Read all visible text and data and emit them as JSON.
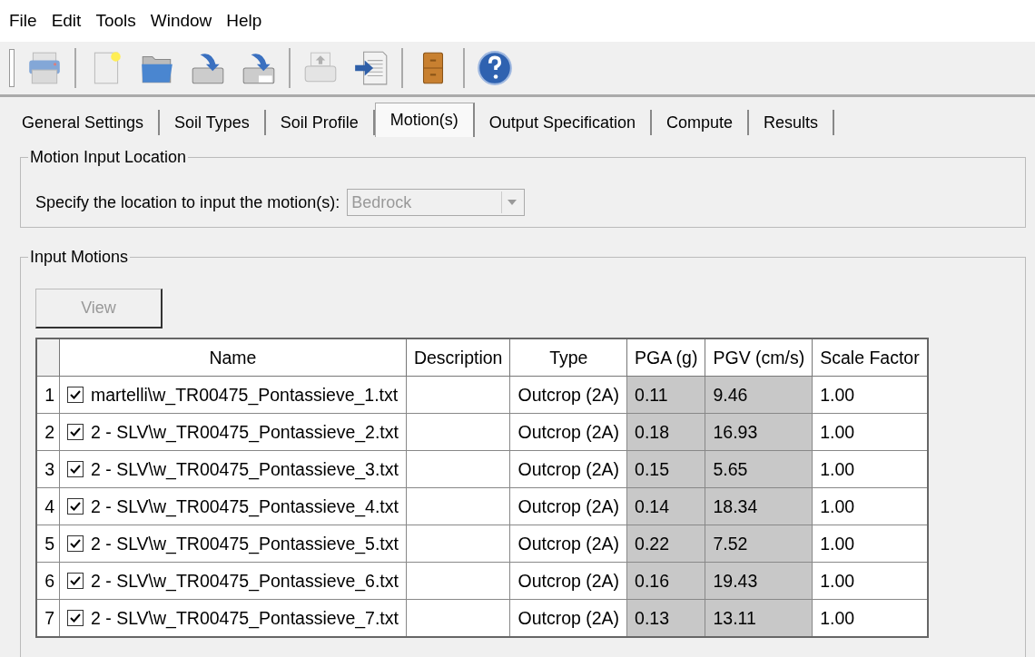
{
  "menu": [
    "File",
    "Edit",
    "Tools",
    "Window",
    "Help"
  ],
  "toolbar": [
    {
      "kind": "printer",
      "disabled": true
    },
    {
      "kind": "sep"
    },
    {
      "kind": "new",
      "disabled": false
    },
    {
      "kind": "open",
      "disabled": false
    },
    {
      "kind": "save",
      "disabled": false
    },
    {
      "kind": "saveas",
      "disabled": false
    },
    {
      "kind": "sep"
    },
    {
      "kind": "export",
      "disabled": true
    },
    {
      "kind": "import",
      "disabled": false
    },
    {
      "kind": "sep"
    },
    {
      "kind": "cabinet",
      "disabled": false
    },
    {
      "kind": "sep"
    },
    {
      "kind": "help",
      "disabled": false
    }
  ],
  "tabs": [
    {
      "label": "General Settings",
      "selected": false
    },
    {
      "label": "Soil Types",
      "selected": false
    },
    {
      "label": "Soil Profile",
      "selected": false
    },
    {
      "label": "Motion(s)",
      "selected": true
    },
    {
      "label": "Output Specification",
      "selected": false
    },
    {
      "label": "Compute",
      "selected": false
    },
    {
      "label": "Results",
      "selected": false
    }
  ],
  "location_group": {
    "title": "Motion Input Location",
    "label": "Specify the location to input the motion(s):",
    "dropdown": {
      "value": "Bedrock",
      "disabled": true
    }
  },
  "motions_group": {
    "title": "Input Motions",
    "view_button": {
      "label": "View",
      "disabled": true
    },
    "table": {
      "columns": [
        {
          "label": "Name",
          "shaded": false
        },
        {
          "label": "Description",
          "shaded": false
        },
        {
          "label": "Type",
          "shaded": false
        },
        {
          "label": "PGA (g)",
          "shaded": true
        },
        {
          "label": "PGV (cm/s)",
          "shaded": true
        },
        {
          "label": "Scale Factor",
          "shaded": false
        }
      ],
      "rows": [
        {
          "number": "1",
          "checked": true,
          "name": "martelli\\w_TR00475_Pontassieve_1.txt",
          "description": "",
          "type": "Outcrop (2A)",
          "pga": "0.11",
          "pgv": "9.46",
          "scale": "1.00"
        },
        {
          "number": "2",
          "checked": true,
          "name": "2 - SLV\\w_TR00475_Pontassieve_2.txt",
          "description": "",
          "type": "Outcrop (2A)",
          "pga": "0.18",
          "pgv": "16.93",
          "scale": "1.00"
        },
        {
          "number": "3",
          "checked": true,
          "name": "2 - SLV\\w_TR00475_Pontassieve_3.txt",
          "description": "",
          "type": "Outcrop (2A)",
          "pga": "0.15",
          "pgv": "5.65",
          "scale": "1.00"
        },
        {
          "number": "4",
          "checked": true,
          "name": "2 - SLV\\w_TR00475_Pontassieve_4.txt",
          "description": "",
          "type": "Outcrop (2A)",
          "pga": "0.14",
          "pgv": "18.34",
          "scale": "1.00"
        },
        {
          "number": "5",
          "checked": true,
          "name": "2 - SLV\\w_TR00475_Pontassieve_5.txt",
          "description": "",
          "type": "Outcrop (2A)",
          "pga": "0.22",
          "pgv": "7.52",
          "scale": "1.00"
        },
        {
          "number": "6",
          "checked": true,
          "name": "2 - SLV\\w_TR00475_Pontassieve_6.txt",
          "description": "",
          "type": "Outcrop (2A)",
          "pga": "0.16",
          "pgv": "19.43",
          "scale": "1.00"
        },
        {
          "number": "7",
          "checked": true,
          "name": "2 - SLV\\w_TR00475_Pontassieve_7.txt",
          "description": "",
          "type": "Outcrop (2A)",
          "pga": "0.13",
          "pgv": "13.11",
          "scale": "1.00"
        }
      ]
    }
  }
}
